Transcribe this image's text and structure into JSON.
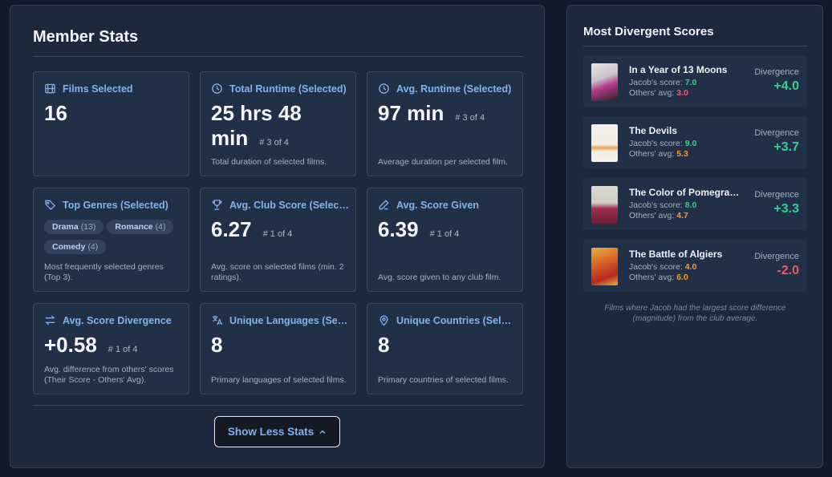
{
  "colors": {
    "accent": "#7fb2ef",
    "positive": "#35d08f",
    "negative": "#f2566a",
    "orange": "#f59e2c"
  },
  "stats": {
    "title": "Member Stats",
    "cards": [
      {
        "icon": "film-icon",
        "label": "Films Selected",
        "value": "16",
        "rank": "",
        "desc": ""
      },
      {
        "icon": "clock-icon",
        "label": "Total Runtime (Selected)",
        "value": "25 hrs 48 min",
        "value_line1": "25 hrs 48",
        "value_line2": "min",
        "rank": "# 3 of 4",
        "desc": "Total duration of selected films."
      },
      {
        "icon": "clock-icon",
        "label": "Avg. Runtime (Selected)",
        "value": "97 min",
        "rank": "# 3 of 4",
        "desc": "Average duration per selected film."
      },
      {
        "icon": "tag-icon",
        "label": "Top Genres (Selected)",
        "value": "",
        "rank": "",
        "desc": "Most frequently selected genres (Top 3).",
        "genres": [
          {
            "name": "Drama",
            "count": "(13)"
          },
          {
            "name": "Romance",
            "count": "(4)"
          },
          {
            "name": "Comedy",
            "count": "(4)"
          }
        ]
      },
      {
        "icon": "trophy-icon",
        "label": "Avg. Club Score (Selected)",
        "value": "6.27",
        "rank": "# 1 of 4",
        "desc": "Avg. score on selected films (min. 2 ratings)."
      },
      {
        "icon": "pencil-icon",
        "label": "Avg. Score Given",
        "value": "6.39",
        "rank": "# 1 of 4",
        "desc": "Avg. score given to any club film."
      },
      {
        "icon": "swap-icon",
        "label": "Avg. Score Divergence",
        "value": "+0.58",
        "rank": "# 1 of 4",
        "desc": "Avg. difference from others' scores (Their Score - Others' Avg)."
      },
      {
        "icon": "translate-icon",
        "label": "Unique Languages (Selected)",
        "value": "8",
        "rank": "",
        "desc": "Primary languages of selected films."
      },
      {
        "icon": "location-pin-icon",
        "label": "Unique Countries (Selected)",
        "value": "8",
        "rank": "",
        "desc": "Primary countries of selected films."
      }
    ],
    "toggle_button": "Show Less Stats"
  },
  "divergent": {
    "title": "Most Divergent Scores",
    "divergence_label": "Divergence",
    "jacob_label": "Jacob's score:",
    "others_label": "Others' avg:",
    "items": [
      {
        "title": "In a Year of 13 Moons",
        "jacob": "7.0",
        "others": "3.0",
        "divergence": "+4.0",
        "others_color": "#f2566a",
        "div_color": "#35d08f"
      },
      {
        "title": "The Devils",
        "jacob": "9.0",
        "others": "5.3",
        "divergence": "+3.7",
        "others_color": "#f59e2c",
        "div_color": "#35d08f"
      },
      {
        "title": "The Color of Pomegranates",
        "jacob": "8.0",
        "others": "4.7",
        "divergence": "+3.3",
        "others_color": "#f59e2c",
        "div_color": "#35d08f"
      },
      {
        "title": "The Battle of Algiers",
        "jacob": "4.0",
        "others": "6.0",
        "divergence": "-2.0",
        "jacob_color": "#f59e2c",
        "others_color": "#f59e2c",
        "div_color": "#f2566a"
      }
    ],
    "footnote": "Films where Jacob had the largest score difference (magnitude) from the club average."
  }
}
